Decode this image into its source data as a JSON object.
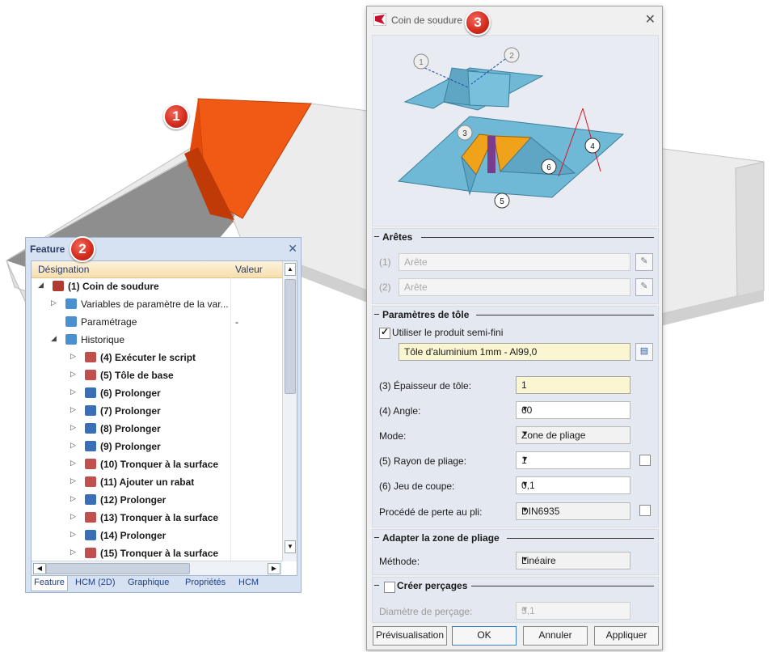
{
  "badges": {
    "one": "1",
    "two": "2",
    "three": "3"
  },
  "feature_panel": {
    "title": "Feature",
    "columns": {
      "designation": "Désignation",
      "value": "Valeur"
    },
    "rows": [
      {
        "label": "(1) Coin de soudure",
        "value": "",
        "bold": true,
        "icon": "weld-corner-icon"
      },
      {
        "label": "Variables de paramètre de la var...",
        "value": "",
        "bold": false,
        "icon": "variables-icon"
      },
      {
        "label": "Paramétrage",
        "value": "-",
        "bold": false,
        "icon": "parameter-icon"
      },
      {
        "label": "Historique",
        "value": "",
        "bold": false,
        "icon": "history-icon"
      },
      {
        "label": "(4) Exécuter le script",
        "value": "",
        "bold": true,
        "icon": "script-icon"
      },
      {
        "label": "(5) Tôle de base",
        "value": "",
        "bold": true,
        "icon": "base-sheet-icon"
      },
      {
        "label": "(6) Prolonger",
        "value": "",
        "bold": true,
        "icon": "extend-icon"
      },
      {
        "label": "(7) Prolonger",
        "value": "",
        "bold": true,
        "icon": "extend-icon"
      },
      {
        "label": "(8) Prolonger",
        "value": "",
        "bold": true,
        "icon": "extend-icon"
      },
      {
        "label": "(9) Prolonger",
        "value": "",
        "bold": true,
        "icon": "extend-icon"
      },
      {
        "label": "(10) Tronquer à la surface",
        "value": "",
        "bold": true,
        "icon": "trim-icon"
      },
      {
        "label": "(11) Ajouter un rabat",
        "value": "",
        "bold": true,
        "icon": "flange-icon"
      },
      {
        "label": "(12) Prolonger",
        "value": "",
        "bold": true,
        "icon": "extend-icon"
      },
      {
        "label": "(13) Tronquer à la surface",
        "value": "",
        "bold": true,
        "icon": "trim-icon"
      },
      {
        "label": "(14) Prolonger",
        "value": "",
        "bold": true,
        "icon": "extend-icon"
      },
      {
        "label": "(15) Tronquer à la surface",
        "value": "",
        "bold": true,
        "icon": "trim-icon"
      }
    ],
    "tabs": [
      "Feature",
      "HCM (2D)",
      "Graphique",
      "Propriétés",
      "HCM"
    ]
  },
  "dialog": {
    "title": "Coin de soudure",
    "illustration_labels": [
      "1",
      "2",
      "3",
      "4",
      "5",
      "6"
    ],
    "aretes": {
      "title": "Arêtes",
      "edge1_label": "(1)",
      "edge1_placeholder": "Arête",
      "edge2_label": "(2)",
      "edge2_placeholder": "Arête"
    },
    "sheet_params": {
      "title": "Paramètres de tôle",
      "use_semi_finished": "Utiliser le produit semi-fini",
      "material": "Tôle d'aluminium 1mm - Al99,0",
      "thickness_label": "(3) Épaisseur de tôle:",
      "thickness_value": "1",
      "angle_label": "(4) Angle:",
      "angle_value": "60",
      "mode_label": "Mode:",
      "mode_value": "Zone de pliage",
      "bend_radius_label": "(5) Rayon de pliage:",
      "bend_radius_value": "1",
      "cut_gap_label": "(6) Jeu de coupe:",
      "cut_gap_value": "0,1",
      "bend_loss_label": "Procédé de perte au pli:",
      "bend_loss_value": "DIN6935"
    },
    "bend_zone": {
      "title": "Adapter la zone de pliage",
      "method_label": "Méthode:",
      "method_value": "Linéaire"
    },
    "holes": {
      "title": "Créer perçages",
      "diameter_label": "Diamètre de perçage:",
      "diameter_value": "5,1"
    },
    "buttons": {
      "preview": "Prévisualisation",
      "ok": "OK",
      "cancel": "Annuler",
      "apply": "Appliquer"
    }
  },
  "colors": {
    "accent_orange": "#f05a14",
    "sheet_blue": "#6fb8d6",
    "badge_red": "#d22a1c"
  }
}
